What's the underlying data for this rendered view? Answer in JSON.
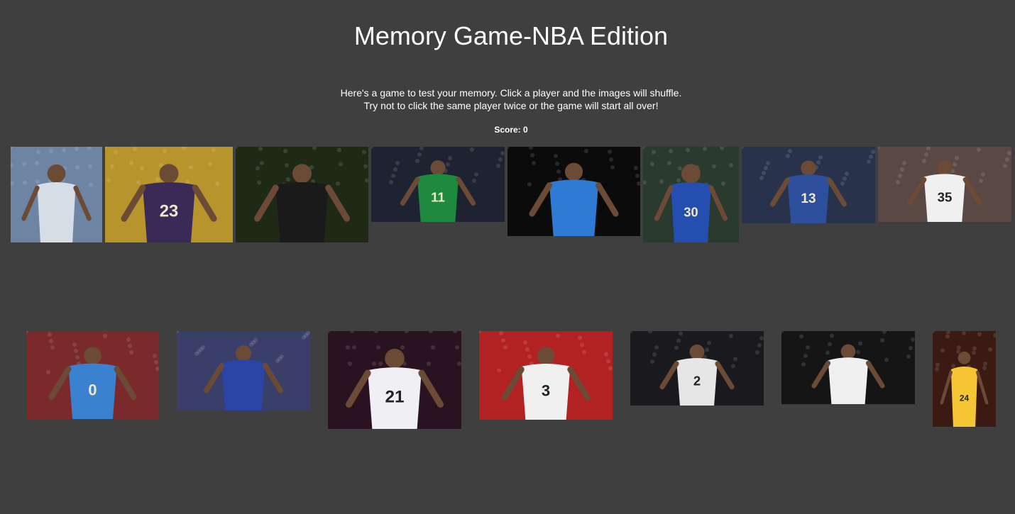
{
  "header": {
    "title": "Memory Game-NBA Edition"
  },
  "instructions": {
    "line1": "Here's a game to test your memory. Click a player and the images will shuffle.",
    "line2": "Try not to click the same player twice or the game will start all over!"
  },
  "score": {
    "label": "Score: 0",
    "value": 0
  },
  "cards": [
    {
      "icon": "player-photo-icon",
      "jersey": "",
      "team_color": "#8fa7c7",
      "bg": "#6d84a2",
      "shirt": "#d5dde6"
    },
    {
      "icon": "player-photo-icon",
      "jersey": "23",
      "team_color": "#3b2b5a",
      "bg": "#b8942c",
      "shirt": "#3a2a58"
    },
    {
      "icon": "player-photo-icon",
      "jersey": "",
      "team_color": "#111111",
      "bg": "#1e2a16",
      "shirt": "#1a1a1a"
    },
    {
      "icon": "player-photo-icon",
      "jersey": "11",
      "team_color": "#1e8a3e",
      "bg": "#1d2330",
      "shirt": "#1e8a3e"
    },
    {
      "icon": "player-photo-icon",
      "jersey": "",
      "team_color": "#3b7dd8",
      "bg": "#0b0b0b",
      "shirt": "#2f7bd4"
    },
    {
      "icon": "player-photo-icon",
      "jersey": "30",
      "team_color": "#1e4fa8",
      "bg": "#2a3a2f",
      "shirt": "#244fb0"
    },
    {
      "icon": "player-photo-icon",
      "jersey": "13",
      "team_color": "#2d57a8",
      "bg": "#28324a",
      "shirt": "#2d4f9c"
    },
    {
      "icon": "player-photo-icon",
      "jersey": "35",
      "team_color": "#f2f2f2",
      "bg": "#5a4844",
      "shirt": "#f0f0f0"
    },
    {
      "icon": "player-photo-icon",
      "jersey": "0",
      "team_color": "#3b86d6",
      "bg": "#7a2a2a",
      "shirt": "#3a82d0"
    },
    {
      "icon": "player-photo-icon",
      "jersey": "",
      "team_color": "#2b47a8",
      "bg": "#3a3f6a",
      "shirt": "#2a45a6"
    },
    {
      "icon": "player-photo-icon",
      "jersey": "21",
      "team_color": "#f3f3f3",
      "bg": "#2a1320",
      "shirt": "#f0f0f4"
    },
    {
      "icon": "player-photo-icon",
      "jersey": "3",
      "team_color": "#cc2b2b",
      "bg": "#b32222",
      "shirt": "#f0f0f0"
    },
    {
      "icon": "player-photo-icon",
      "jersey": "2",
      "team_color": "#e8e8e8",
      "bg": "#1a1a1e",
      "shirt": "#e6e6e6"
    },
    {
      "icon": "player-photo-icon",
      "jersey": "",
      "team_color": "#c82a2a",
      "bg": "#151515",
      "shirt": "#f0f0f0"
    },
    {
      "icon": "player-photo-icon",
      "jersey": "24",
      "team_color": "#f5c533",
      "bg": "#3a1a12",
      "shirt": "#f5c533"
    }
  ]
}
